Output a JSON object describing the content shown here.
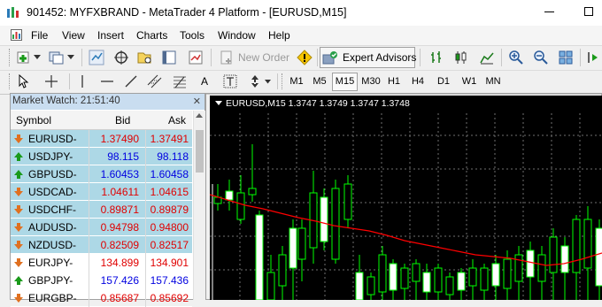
{
  "window": {
    "title": "901452: MYFXBRAND - MetaTrader 4 Platform - [EURUSD,M15]"
  },
  "menu": {
    "items": [
      {
        "label": "File"
      },
      {
        "label": "View"
      },
      {
        "label": "Insert"
      },
      {
        "label": "Charts"
      },
      {
        "label": "Tools"
      },
      {
        "label": "Window"
      },
      {
        "label": "Help"
      }
    ]
  },
  "toolbar": {
    "new_order_label": "New Order",
    "expert_advisors_label": "Expert Advisors",
    "timeframes": [
      "M1",
      "M5",
      "M15",
      "M30",
      "H1",
      "H4",
      "D1",
      "W1",
      "MN"
    ],
    "active_timeframe": "M15"
  },
  "market_watch": {
    "title": "Market Watch: 21:51:40",
    "columns": {
      "symbol": "Symbol",
      "bid": "Bid",
      "ask": "Ask"
    },
    "rows": [
      {
        "symbol": "EURUSD-",
        "bid": "1.37490",
        "ask": "1.37491",
        "direction": "down",
        "color": "#e00000"
      },
      {
        "symbol": "USDJPY-",
        "bid": "98.115",
        "ask": "98.118",
        "direction": "up",
        "color": "#0000e0"
      },
      {
        "symbol": "GBPUSD-",
        "bid": "1.60453",
        "ask": "1.60458",
        "direction": "up",
        "color": "#0000e0"
      },
      {
        "symbol": "USDCAD-",
        "bid": "1.04611",
        "ask": "1.04615",
        "direction": "down",
        "color": "#e00000"
      },
      {
        "symbol": "USDCHF-",
        "bid": "0.89871",
        "ask": "0.89879",
        "direction": "down",
        "color": "#e00000"
      },
      {
        "symbol": "AUDUSD-",
        "bid": "0.94798",
        "ask": "0.94800",
        "direction": "down",
        "color": "#e00000"
      },
      {
        "symbol": "NZDUSD-",
        "bid": "0.82509",
        "ask": "0.82517",
        "direction": "down",
        "color": "#e00000"
      },
      {
        "symbol": "EURJPY-",
        "bid": "134.899",
        "ask": "134.901",
        "direction": "down",
        "color": "#e00000"
      },
      {
        "symbol": "GBPJPY-",
        "bid": "157.426",
        "ask": "157.436",
        "direction": "up",
        "color": "#0000e0"
      },
      {
        "symbol": "EURGBP-",
        "bid": "0.85687",
        "ask": "0.85692",
        "direction": "down",
        "color": "#e00000"
      }
    ]
  },
  "chart": {
    "header": "EURUSD,M15  1.3747 1.3749 1.3747 1.3748",
    "bull_color": "#ffffff",
    "bear_color": "#00ff00",
    "ma_color": "#ff0000",
    "grid_color": "#707070"
  }
}
